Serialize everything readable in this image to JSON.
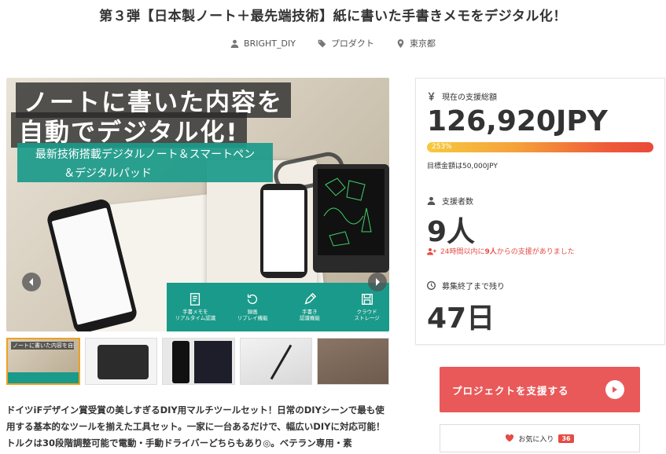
{
  "project": {
    "title": "第３弾【日本製ノート＋最先端技術】紙に書いた手書きメモをデジタル化！",
    "owner": "BRIGHT_DIY",
    "category": "プロダクト",
    "location": "東京都"
  },
  "hero": {
    "headline_line1": "ノートに書いた内容を",
    "headline_line2": "自動でデジタル化!",
    "sub_line1": "最新技術搭載デジタルノート＆スマートペン",
    "sub_line2": "＆デジタルパッド",
    "features": [
      {
        "label": "手書メモを\nリアルタイム認識",
        "icon": "memo-icon"
      },
      {
        "label": "録画\nリプレイ機能",
        "icon": "replay-icon"
      },
      {
        "label": "手書き\n認識機能",
        "icon": "pen-icon"
      },
      {
        "label": "クラウド\nストレージ",
        "icon": "save-icon"
      }
    ]
  },
  "thumbnails": [
    {
      "label": "ノートに書いた内容を自動でデジタル化!"
    },
    {
      "label": ""
    },
    {
      "label": ""
    },
    {
      "label": ""
    },
    {
      "label": ""
    }
  ],
  "description": "ドイツiFデザイン賞受賞の美しすぎるDIY用マルチツールセット！日常のDIYシーンで最も使用する基本的なツールを揃えた工具セット。一家に一台あるだけで、幅広いDIYに対応可能！トルクは30段階調整可能で電動・手動ドライバーどちらもあり◎。ベテラン専用・素",
  "funding": {
    "total_label": "現在の支援総額",
    "total_value": "126,920JPY",
    "progress_percent": 253,
    "progress_label": "253%",
    "goal_text": "目標金額は50,000JPY",
    "supporters_label": "支援者数",
    "supporters_value": "9人",
    "recent_prefix": "24時間以内に",
    "recent_count": "9人",
    "recent_suffix": "からの支援がありました",
    "remaining_label": "募集終了まで残り",
    "remaining_value": "47日"
  },
  "actions": {
    "support_label": "プロジェクトを支援する",
    "favorite_label": "お気に入り",
    "favorite_count": "36"
  },
  "colors": {
    "accent": "#e9595a",
    "teal": "#1a9a8a",
    "progress_start": "#f7c93e",
    "progress_end": "#e94a3a"
  }
}
